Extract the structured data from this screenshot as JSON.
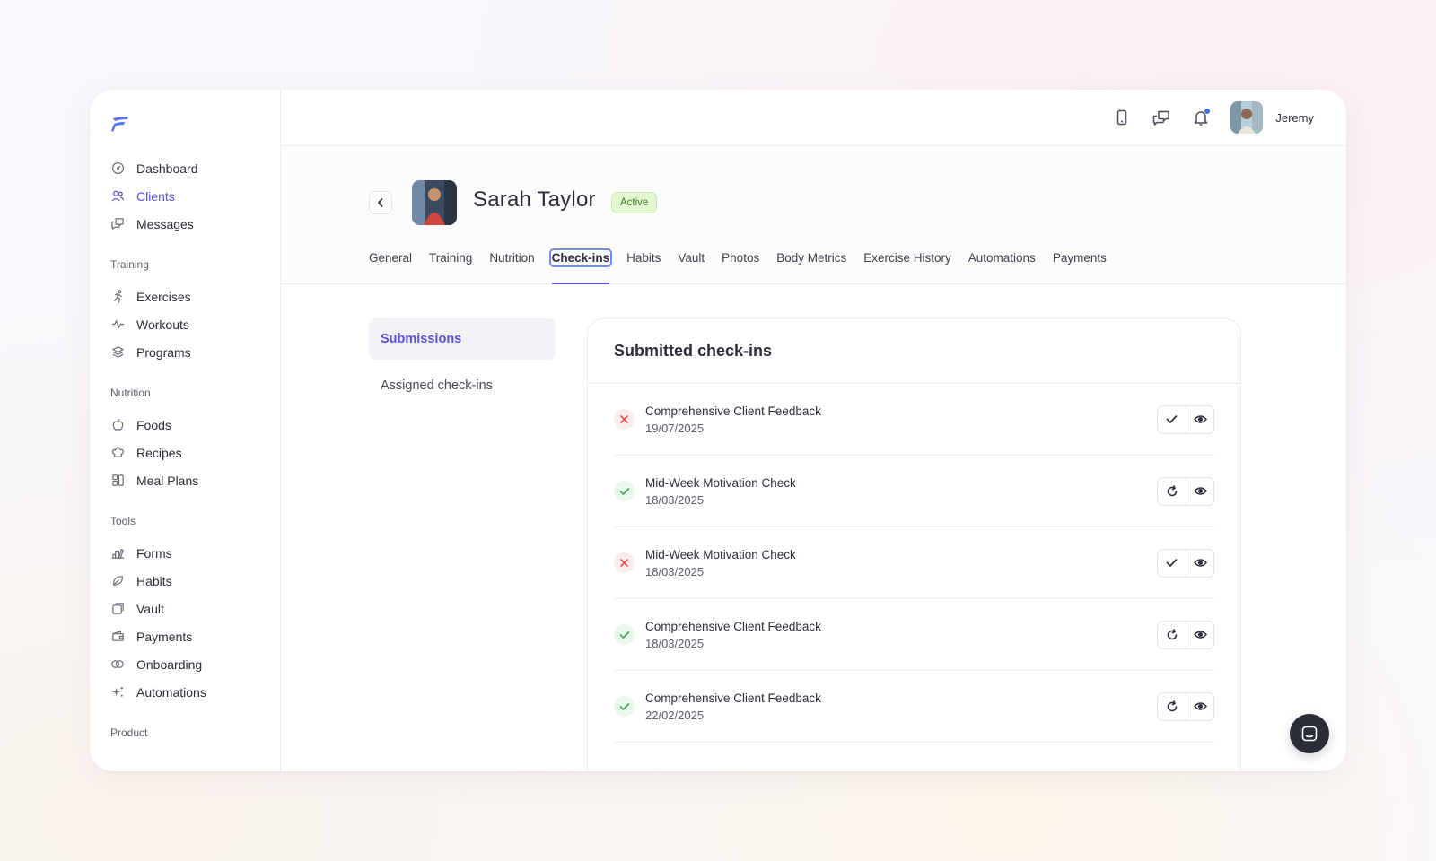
{
  "user": {
    "name": "Jeremy"
  },
  "sidebar": {
    "main_items": [
      {
        "label": "Dashboard",
        "icon": "dashboard-icon"
      },
      {
        "label": "Clients",
        "icon": "users-icon",
        "active": true
      },
      {
        "label": "Messages",
        "icon": "messages-icon"
      }
    ],
    "sections": [
      {
        "title": "Training",
        "items": [
          {
            "label": "Exercises",
            "icon": "running-icon"
          },
          {
            "label": "Workouts",
            "icon": "pulse-icon"
          },
          {
            "label": "Programs",
            "icon": "layers-icon"
          }
        ]
      },
      {
        "title": "Nutrition",
        "items": [
          {
            "label": "Foods",
            "icon": "apple-icon"
          },
          {
            "label": "Recipes",
            "icon": "chef-hat-icon"
          },
          {
            "label": "Meal Plans",
            "icon": "grid-icon"
          }
        ]
      },
      {
        "title": "Tools",
        "items": [
          {
            "label": "Forms",
            "icon": "forms-icon"
          },
          {
            "label": "Habits",
            "icon": "leaf-icon"
          },
          {
            "label": "Vault",
            "icon": "vault-icon"
          },
          {
            "label": "Payments",
            "icon": "wallet-icon"
          },
          {
            "label": "Onboarding",
            "icon": "rings-icon"
          },
          {
            "label": "Automations",
            "icon": "sparkle-icon"
          }
        ]
      },
      {
        "title": "Product",
        "items": []
      }
    ]
  },
  "client": {
    "name": "Sarah Taylor",
    "status": "Active"
  },
  "tabs": [
    "General",
    "Training",
    "Nutrition",
    "Check-ins",
    "Habits",
    "Vault",
    "Photos",
    "Body Metrics",
    "Exercise History",
    "Automations",
    "Payments"
  ],
  "active_tab": "Check-ins",
  "subnav": {
    "submissions": "Submissions",
    "assigned": "Assigned check-ins"
  },
  "card": {
    "title": "Submitted check-ins",
    "rows": [
      {
        "name": "Comprehensive Client Feedback",
        "date": "19/07/2025",
        "status": "incomplete",
        "primary_action": "mark-complete"
      },
      {
        "name": "Mid-Week Motivation Check",
        "date": "18/03/2025",
        "status": "complete",
        "primary_action": "reopen"
      },
      {
        "name": "Mid-Week Motivation Check",
        "date": "18/03/2025",
        "status": "incomplete",
        "primary_action": "mark-complete"
      },
      {
        "name": "Comprehensive Client Feedback",
        "date": "18/03/2025",
        "status": "complete",
        "primary_action": "reopen"
      },
      {
        "name": "Comprehensive Client Feedback",
        "date": "22/02/2025",
        "status": "complete",
        "primary_action": "reopen"
      }
    ]
  },
  "colors": {
    "accent": "#5b4fd6",
    "success": "#3fae5a",
    "danger": "#e05555",
    "badge_bg": "#e3f7d2"
  }
}
